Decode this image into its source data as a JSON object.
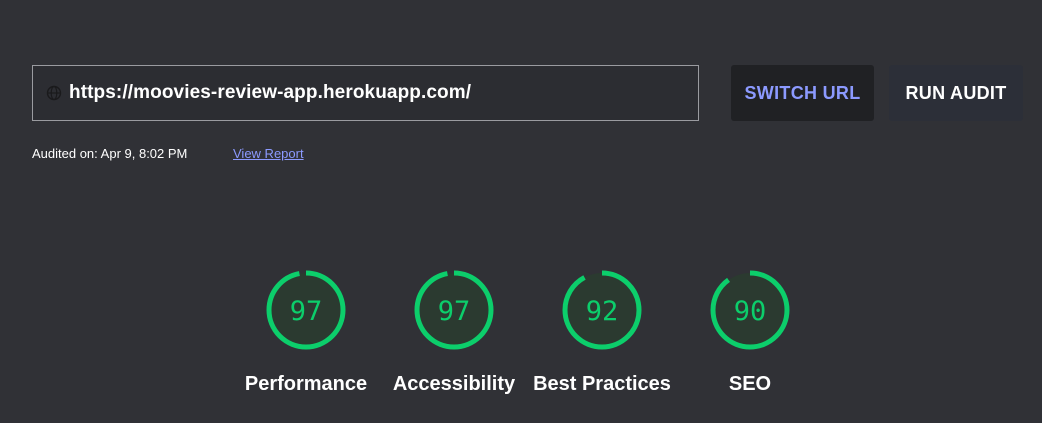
{
  "url_bar": {
    "value": "https://moovies-review-app.herokuapp.com/",
    "icon": "globe-icon"
  },
  "buttons": {
    "switch_url": "SWITCH URL",
    "run_audit": "RUN AUDIT"
  },
  "audit_meta": {
    "audited_on": "Audited on: Apr 9, 8:02 PM",
    "view_report": "View Report"
  },
  "colors": {
    "pass": "#0cce6b",
    "accent": "#8c9aff",
    "background": "#303136"
  },
  "scores": [
    {
      "id": "performance",
      "label": "Performance",
      "value": 97
    },
    {
      "id": "accessibility",
      "label": "Accessibility",
      "value": 97
    },
    {
      "id": "best-practices",
      "label": "Best Practices",
      "value": 92
    },
    {
      "id": "seo",
      "label": "SEO",
      "value": 90
    }
  ]
}
